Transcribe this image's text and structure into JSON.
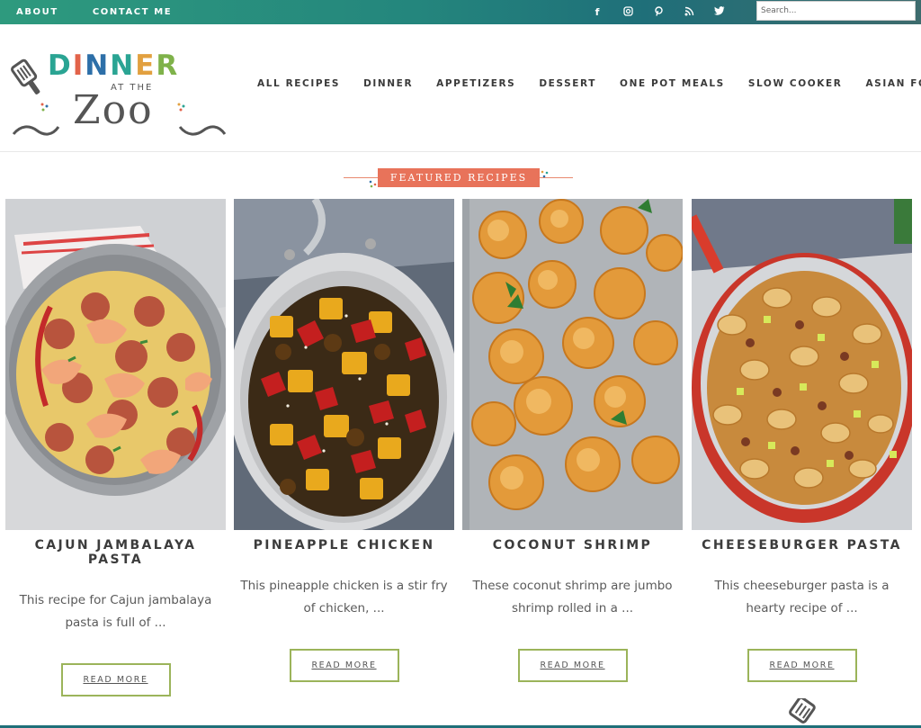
{
  "topbar": {
    "links": [
      "ABOUT",
      "CONTACT ME"
    ],
    "social_icons": [
      "facebook-icon",
      "instagram-icon",
      "pinterest-icon",
      "rss-icon",
      "twitter-icon"
    ],
    "search_placeholder": "Search..."
  },
  "logo": {
    "dinner": [
      "D",
      "I",
      "N",
      "N",
      "E",
      "R"
    ],
    "at_the": "AT THE",
    "zoo": "Zoo"
  },
  "main_nav": [
    "ALL RECIPES",
    "DINNER",
    "APPETIZERS",
    "DESSERT",
    "ONE POT MEALS",
    "SLOW COOKER",
    "ASIAN FOOD"
  ],
  "featured": {
    "label": "FEATURED RECIPES"
  },
  "cards": [
    {
      "title": "CAJUN JAMBALAYA PASTA",
      "excerpt": "This recipe for Cajun jambalaya pasta is full of ...",
      "button": "READ MORE"
    },
    {
      "title": "PINEAPPLE CHICKEN",
      "excerpt": "This pineapple chicken is a stir fry of chicken, ...",
      "button": "READ MORE"
    },
    {
      "title": "COCONUT SHRIMP",
      "excerpt": "These coconut shrimp are jumbo shrimp rolled in a ...",
      "button": "READ MORE"
    },
    {
      "title": "CHEESEBURGER PASTA",
      "excerpt": "This cheeseburger pasta is a hearty recipe of ...",
      "button": "READ MORE"
    }
  ],
  "colors": {
    "topbar_start": "#2e9a7e",
    "topbar_end": "#1f6f79",
    "featured_label": "#e8735a",
    "button_border": "#9bb45a"
  }
}
